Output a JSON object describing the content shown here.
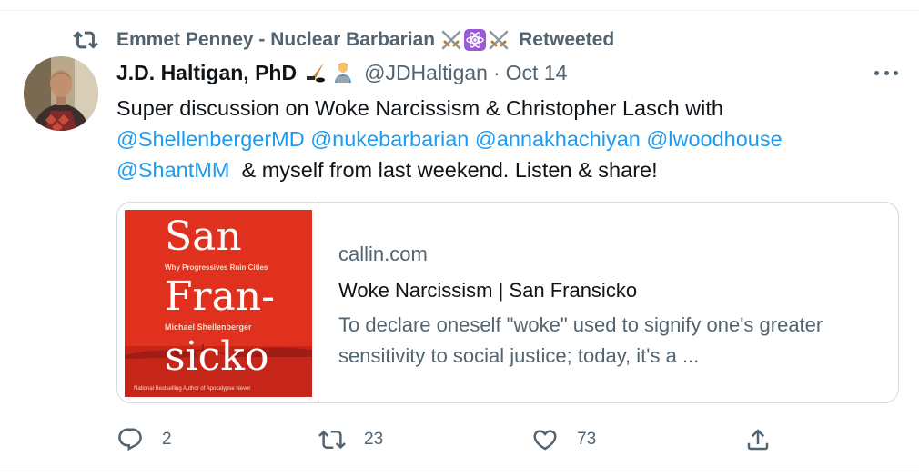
{
  "retweet": {
    "icon": "retweet-icon",
    "retweeter_name": "Emmet Penney - Nuclear Barbarian",
    "retweeter_emojis": [
      "crossed-swords-emoji",
      "atom-emoji",
      "crossed-swords-emoji"
    ],
    "label": "Retweeted"
  },
  "tweet": {
    "display_name": "J.D. Haltigan, PhD",
    "name_emojis": [
      "hockey-stick-emoji",
      "technologist-emoji"
    ],
    "handle": "@JDHaltigan",
    "separator": "·",
    "date": "Oct 14",
    "text_intro": "Super discussion on Woke Narcissism & Christopher Lasch with",
    "mentions": [
      "@ShellenbergerMD",
      "@nukebarbarian",
      "@annakhachiyan",
      "@lwoodhouse",
      "@ShantMM"
    ],
    "text_outro": "& myself from last weekend. Listen & share!"
  },
  "card": {
    "domain": "callin.com",
    "title": "Woke Narcissism | San Fransicko",
    "description": "To declare oneself \"woke\" used to signify one's greater sensitivity to social justice; today, it's a ...",
    "book": {
      "line1": "San",
      "subtitle": "Why Progressives Ruin Cities",
      "line2": "Fran-",
      "author": "Michael Shellenberger",
      "line3": "sicko",
      "tagline": "National Bestselling Author of Apocalypse Never",
      "background_color": "#e0301e"
    }
  },
  "actions": {
    "reply_count": "2",
    "retweet_count": "23",
    "like_count": "73"
  },
  "colors": {
    "accent": "#1d9bf0",
    "secondary_text": "#536471",
    "border": "#cfd9de"
  }
}
